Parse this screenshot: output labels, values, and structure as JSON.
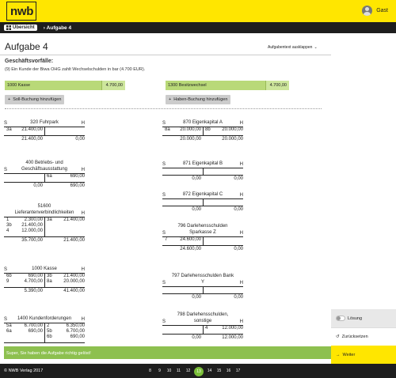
{
  "header": {
    "logo": "nwb",
    "user": "Gast"
  },
  "nav": {
    "overview": "Übersicht",
    "breadcrumb": "Aufgabe 4"
  },
  "page": {
    "title": "Aufgabe 4",
    "toggle_text": "Aufgabentext ausklappen",
    "section_label": "Geschäftsvorfälle:",
    "case_text": "(9)  Ein Kunde der Biwa OHG zahlt Wechselschulden in bar (4.700 EUR).",
    "soll_account": {
      "name": "1000 Kasse",
      "amount": "4.700,00"
    },
    "haben_account": {
      "name": "1300 Besitzwechsel",
      "amount": "4.700,00"
    },
    "add_soll": "Soll-Buchung hinzufügen",
    "add_haben": "Haben-Buchung hinzufügen"
  },
  "t_accounts": {
    "fuhrpark": {
      "s": "S",
      "name": "320 Fuhrpark",
      "h": "H",
      "rows": [
        {
          "lc": "3a",
          "la": "21.400,00",
          "rc": "",
          "ra": ""
        }
      ],
      "sum_l": "21.400,00",
      "sum_r": "0,00"
    },
    "bga": {
      "s": "S",
      "name": "400 Betriebs- und Geschäftsausstattung",
      "h": "H",
      "rows": [
        {
          "lc": "",
          "la": "",
          "rc": "6a",
          "ra": "690,00"
        }
      ],
      "sum_l": "0,00",
      "sum_r": "690,00"
    },
    "lieferanten": {
      "s": "",
      "name": "51600 Lieferantenverbindlichkeiten",
      "h": "H",
      "rows": [
        {
          "lc": "1",
          "la": "2.300,00",
          "rc": "3a",
          "ra": "21.400,00"
        },
        {
          "lc": "3b",
          "la": "21.400,00",
          "rc": "",
          "ra": ""
        },
        {
          "lc": "4",
          "la": "12.000,00",
          "rc": "",
          "ra": ""
        }
      ],
      "sum_l": "35.700,00",
      "sum_r": "21.400,00"
    },
    "kasse": {
      "s": "S",
      "name": "1000 Kasse",
      "h": "H",
      "rows": [
        {
          "lc": "6b",
          "la": "690,00",
          "rc": "3b",
          "ra": "21.400,00"
        },
        {
          "lc": "9",
          "la": "4.700,00",
          "rc": "8a",
          "ra": "20.000,00"
        }
      ],
      "sum_l": "5.390,00",
      "sum_r": "41.400,00"
    },
    "kunden": {
      "s": "S",
      "name": "1400 Kundenforderungen",
      "h": "H",
      "rows": [
        {
          "lc": "5a",
          "la": "6.700,00",
          "rc": "2",
          "ra": "6.350,00"
        },
        {
          "lc": "6a",
          "la": "690,00",
          "rc": "5b",
          "ra": "6.700,00"
        },
        {
          "lc": "",
          "la": "",
          "rc": "6b",
          "ra": "690,00"
        }
      ],
      "sum_l": "",
      "sum_r": ""
    },
    "ek_a": {
      "s": "S",
      "name": "870 Eigenkapital A",
      "h": "H",
      "rows": [
        {
          "lc": "8a",
          "la": "20.000,00",
          "rc": "8b",
          "ra": "20.000,00"
        }
      ],
      "sum_l": "20.000,00",
      "sum_r": "20.000,00"
    },
    "ek_b": {
      "s": "S",
      "name": "871 Eigenkapital B",
      "h": "H",
      "rows": [],
      "sum_l": "0,00",
      "sum_r": "0,00"
    },
    "ek_c": {
      "s": "S",
      "name": "872 Eigenkapital C",
      "h": "H",
      "rows": [],
      "sum_l": "0,00",
      "sum_r": "0,00"
    },
    "darl_z": {
      "s": "S",
      "name": "796 Darlehensschulden Sparkasse Z",
      "h": "H",
      "rows": [
        {
          "lc": "7",
          "la": "24.600,00",
          "rc": "",
          "ra": ""
        }
      ],
      "sum_l": "24.600,00",
      "sum_r": "0,00"
    },
    "darl_y": {
      "s": "S",
      "name": "797 Darlehensschulden Bank Y",
      "h": "H",
      "rows": [],
      "sum_l": "0,00",
      "sum_r": "0,00"
    },
    "darl_s": {
      "s": "S",
      "name": "798 Darlehensschulden, sonstige",
      "h": "H",
      "rows": [
        {
          "lc": "",
          "la": "",
          "rc": "4",
          "ra": "12.000,00"
        }
      ],
      "sum_l": "0,00",
      "sum_r": "12.000,00"
    }
  },
  "message": "Super, Sie haben die Aufgabe richtig gelöst!",
  "side_panel": {
    "solution": "Lösung",
    "reset": "Zurücksetzen",
    "next": "Weiter"
  },
  "footer": {
    "copyright": "© NWB Verlag 2017",
    "pages": [
      "8",
      "9",
      "10",
      "11",
      "12",
      "13",
      "14",
      "15",
      "16",
      "17"
    ],
    "active_page": "13"
  },
  "colors": {
    "brand_yellow": "#ffe600",
    "success_green": "#8dc04f",
    "account_green": "#b9d978",
    "dark": "#1e1e1e"
  }
}
